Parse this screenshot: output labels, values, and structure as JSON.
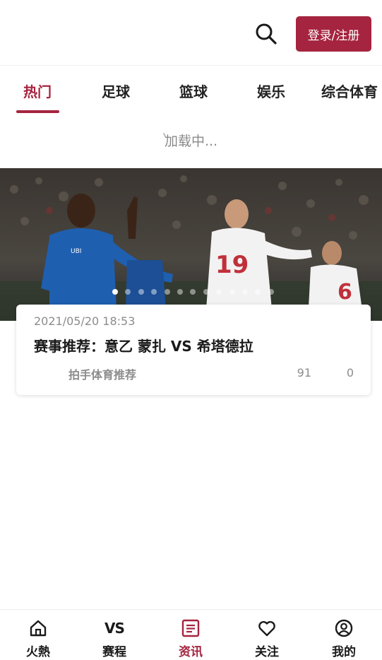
{
  "header": {
    "login_label": "登录/注册"
  },
  "tabs": [
    {
      "label": "热门"
    },
    {
      "label": "足球"
    },
    {
      "label": "篮球"
    },
    {
      "label": "娱乐"
    },
    {
      "label": "综合体育"
    }
  ],
  "loading_text": "加载中...",
  "banner": {
    "slide_count": 13,
    "active_slide": 1,
    "jersey_19": "19",
    "jersey_6": "6"
  },
  "article": {
    "time": "2021/05/20 18:53",
    "title": "赛事推荐：意乙 蒙扎 VS 希塔德拉",
    "source": "拍手体育推荐",
    "views": "91",
    "comments": "0"
  },
  "bottom_nav": [
    {
      "label": "火熱",
      "icon": "home-icon"
    },
    {
      "label": "赛程",
      "icon": "vs-icon",
      "icon_text": "VS"
    },
    {
      "label": "资讯",
      "icon": "news-icon"
    },
    {
      "label": "关注",
      "icon": "heart-icon"
    },
    {
      "label": "我的",
      "icon": "user-icon"
    }
  ],
  "colors": {
    "accent": "#a5243f",
    "text_primary": "#1a1a1a",
    "text_secondary": "#8c8c8c"
  }
}
